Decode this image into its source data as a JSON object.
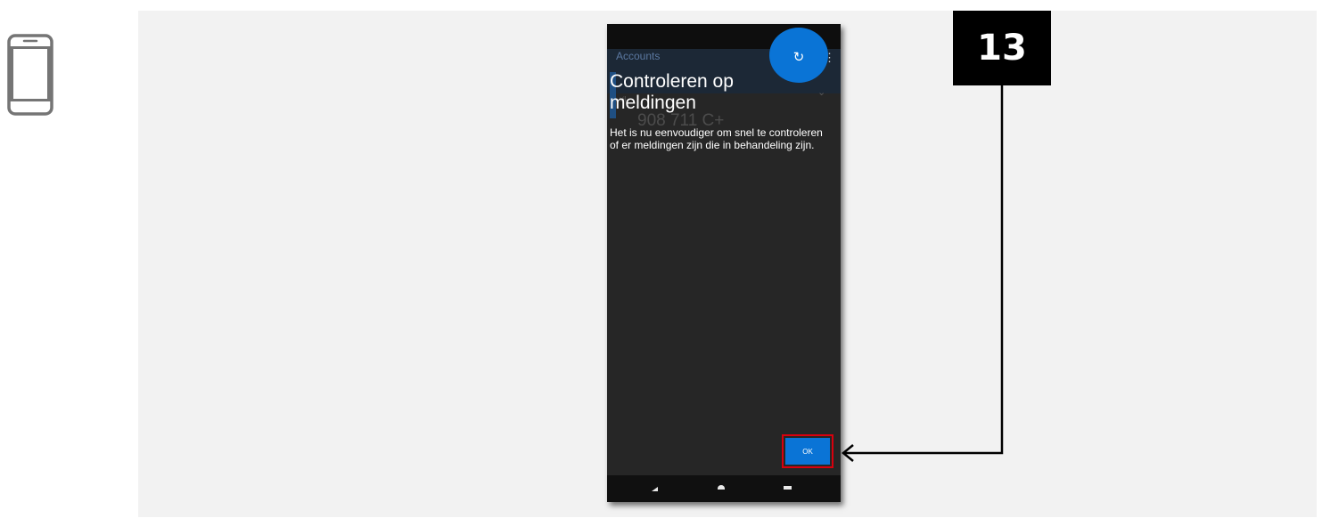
{
  "step": {
    "number": "13"
  },
  "phone_screen": {
    "background": {
      "appbar_title": "Accounts",
      "refresh_icon": "↻",
      "menu_icon": "⋮",
      "chevron_icon": "⌄",
      "account_label": "vil",
      "account_number": "908 711 C+"
    },
    "dialog": {
      "title": "Controleren op meldingen",
      "body": "Het is nu eenvoudiger om snel te controleren of er meldingen zijn die in behandeling zijn.",
      "ok_label": "OK"
    },
    "navbar": {
      "icons": [
        "back-icon",
        "home-icon",
        "recents-icon"
      ]
    }
  },
  "colors": {
    "panel": "#f2f2f2",
    "phone_bg": "#262626",
    "accent_blue": "#0a74d6",
    "highlight_red": "#d9000d",
    "badge_bg": "#000000"
  }
}
